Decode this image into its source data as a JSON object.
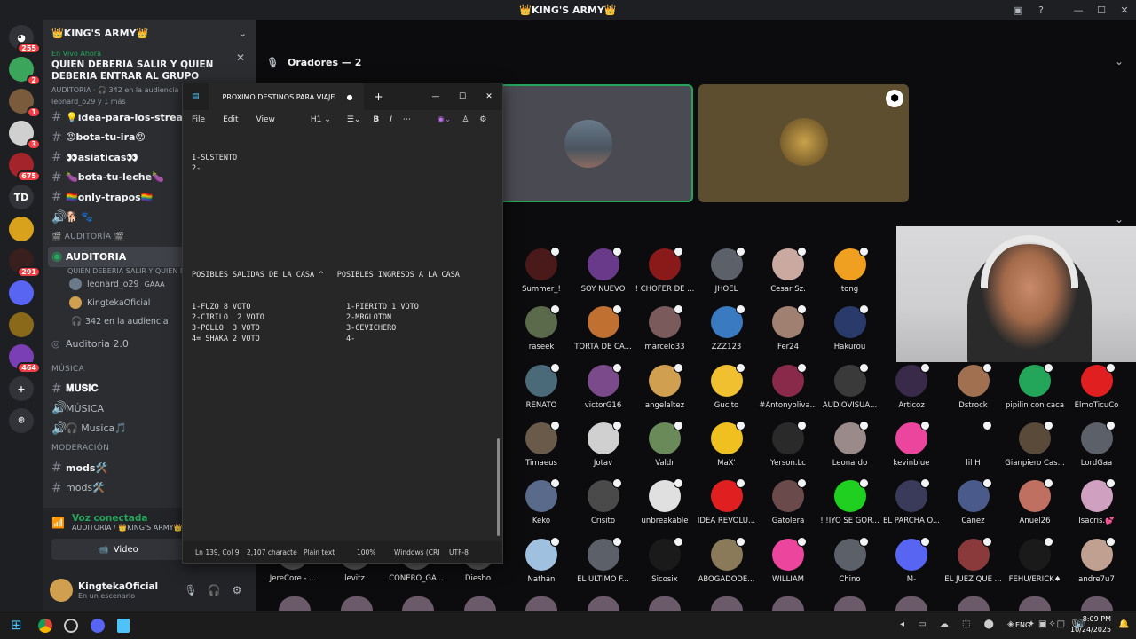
{
  "window": {
    "title": "👑KING'S ARMY👑"
  },
  "servers": [
    {
      "badge": "255",
      "color": "#5865f2",
      "label": ""
    },
    {
      "badge": "2",
      "color": "#3ba55c",
      "label": ""
    },
    {
      "badge": "1",
      "color": "#7a5c3c",
      "label": ""
    },
    {
      "badge": "3",
      "color": "#d0d0d0",
      "label": ""
    },
    {
      "badge": "675",
      "color": "#a3242a",
      "label": ""
    },
    {
      "badge": "",
      "color": "#313338",
      "label": "TD"
    },
    {
      "badge": "",
      "color": "#d9a21c",
      "label": ""
    },
    {
      "badge": "291",
      "color": "#3a1f1f",
      "label": ""
    },
    {
      "badge": "",
      "color": "#5865f2",
      "label": ""
    },
    {
      "badge": "",
      "color": "#8a6a1a",
      "label": ""
    },
    {
      "badge": "464",
      "color": "#7b3fb5",
      "label": ""
    }
  ],
  "sidebar": {
    "server_name": "👑KING'S ARMY👑",
    "live_label": "En Vivo Ahora",
    "stage_title": "QUIEN DEBERIA SALIR Y QUIEN DEBERIA ENTRAR AL GRUPO",
    "stage_meta": "AUDITORIA · 🎧 342 en la audiencia",
    "stage_users": "leonard_o29 y 1 más",
    "channels": [
      "💡idea-para-los-streams💡",
      "😡bota-tu-ira😡",
      "👀asiaticas👀",
      "🍆bota-tu-leche🍆",
      "🏳️‍🌈only-trapos🏳️‍🌈"
    ],
    "cat_auditoria": "🎬 AUDITORÍA 🎬",
    "auditoria_channel": "AUDITORIA",
    "auditoria_sub": "QUIEN DEBERIA SALIR Y QUIEN DEBERIA ENTRAR AL GRUPO",
    "members": [
      {
        "name": "leonard_o29",
        "tag": "GAAA"
      },
      {
        "name": "KingtekaOficial",
        "tag": ""
      }
    ],
    "audience": "342 en la audiencia",
    "auditoria2": "Auditoria 2.0",
    "cat_musica": "MÚSICA",
    "music_channels": [
      "𝐌𝐔𝐒𝐈𝐂",
      "MÚSICA",
      "🎧 Musica🎵"
    ],
    "cat_moderacion": "MODERACIÓN",
    "mod_channels": [
      "mods🛠️",
      "mods🛠️"
    ]
  },
  "voice_panel": {
    "status": "Voz conectada",
    "location": "AUDITORIA / 👑KING'S ARMY👑",
    "video_button": "Video"
  },
  "user_panel": {
    "name": "KingtekaOficial",
    "status": "En un escenario"
  },
  "stage": {
    "speakers_header": "Oradores — 2"
  },
  "notepad": {
    "title": "PROXIMO DESTINOS PARA VIAJE.",
    "menu": [
      "File",
      "Edit",
      "View"
    ],
    "heading": "H1",
    "lines": [
      "1-SUSTENTO",
      "2-",
      "",
      "",
      "",
      "",
      "",
      "",
      "",
      "",
      "",
      "POSIBLES SALIDAS DE LA CASA ^   POSIBLES INGRESOS A LA CASA",
      "",
      "",
      "1-FUZO 8 VOTO                     1-PIERITO 1 VOTO",
      "2-CIRILO  2 VOTO                  2-MRGLOTON",
      "3-POLLO  3 VOTO                   3-CEVICHERO",
      "4= SHAKA 2 VOTO                   4-"
    ],
    "status": {
      "pos": "Ln 139, Col 9",
      "chars": "2,107 characte",
      "format": "Plain text",
      "zoom": "100%",
      "eol": "Windows (CRI",
      "enc": "UTF-8"
    }
  },
  "audience": [
    {
      "name": "Summer_!",
      "color": "#4a1a1a"
    },
    {
      "name": "SOY NUEVO",
      "color": "#6a3a8a"
    },
    {
      "name": "! CHOFER DE ...",
      "color": "#8a1a1a"
    },
    {
      "name": "JHOEL",
      "color": "#5c6069"
    },
    {
      "name": "Cesar Sz.",
      "color": "#c9a9a0"
    },
    {
      "name": "tong",
      "color": "#f0a020"
    },
    {
      "name": "raseek",
      "color": "#5a6a4a"
    },
    {
      "name": "TORTA DE CA...",
      "color": "#c07030"
    },
    {
      "name": "marcelo33",
      "color": "#7a5a5a"
    },
    {
      "name": "ZZZ123",
      "color": "#3a7ac0"
    },
    {
      "name": "Fer24",
      "color": "#a08070"
    },
    {
      "name": "Hakurou",
      "color": "#2a3a6a"
    },
    {
      "name": "RENATO",
      "color": "#4a6a7a"
    },
    {
      "name": "victorG16",
      "color": "#7a4a8a"
    },
    {
      "name": "angelaltez",
      "color": "#d0a050"
    },
    {
      "name": "Gucito",
      "color": "#f0c030"
    },
    {
      "name": "#Antonyoliva...",
      "color": "#8a2a4a"
    },
    {
      "name": "AUDIOVISUA...",
      "color": "#3a3a3a"
    },
    {
      "name": "Articoz",
      "color": "#3a2a4a"
    },
    {
      "name": "Dstrock",
      "color": "#a07050"
    },
    {
      "name": "pipilin con caca",
      "color": "#23a55a"
    },
    {
      "name": "ElmoTicuCo",
      "color": "#e02020"
    },
    {
      "name": "Timaeus",
      "color": "#6a5a4a"
    },
    {
      "name": "Jotav",
      "color": "#d0d0d0"
    },
    {
      "name": "Valdr",
      "color": "#6a8a5a"
    },
    {
      "name": "MaX'",
      "color": "#f0c020"
    },
    {
      "name": "Yerson.Lc",
      "color": "#2a2a2a"
    },
    {
      "name": "Leonardo",
      "color": "#9a8a8a"
    },
    {
      "name": "kevinblue",
      "color": "#eb459e"
    },
    {
      "name": "lil H",
      "color": "#0c0c0e"
    },
    {
      "name": "Gianpiero Cas...",
      "color": "#5a4a3a"
    },
    {
      "name": "LordGaa",
      "color": "#5c6069"
    },
    {
      "name": "Keko",
      "color": "#5a6a8a"
    },
    {
      "name": "Crisito",
      "color": "#4a4a4a"
    },
    {
      "name": "unbreakable",
      "color": "#e0e0e0"
    },
    {
      "name": "IDEA REVOLU...",
      "color": "#e02020"
    },
    {
      "name": "Gatolera",
      "color": "#6a4a4a"
    },
    {
      "name": "! !IYO SE GOR...",
      "color": "#20d020"
    },
    {
      "name": "EL PARCHA O...",
      "color": "#3a3a5a"
    },
    {
      "name": "Cánez",
      "color": "#4a5a8a"
    },
    {
      "name": "Anuel26",
      "color": "#c07060"
    },
    {
      "name": "Isacris.💕",
      "color": "#d0a0c0"
    },
    {
      "name": "Nathán",
      "color": "#a0c0e0"
    },
    {
      "name": "EL ULTIMO F...",
      "color": "#5c6069"
    },
    {
      "name": "Sicosix",
      "color": "#1a1a1a"
    },
    {
      "name": "ABOGADODE...",
      "color": "#8a7a5a"
    },
    {
      "name": "WILLIAM",
      "color": "#eb459e"
    },
    {
      "name": "Chino",
      "color": "#5c6069"
    },
    {
      "name": "M-",
      "color": "#5865f2"
    },
    {
      "name": "EL JUEZ QUE ...",
      "color": "#8a3a3a"
    },
    {
      "name": "FEHU/ERICK♠",
      "color": "#1a1a1a"
    },
    {
      "name": "andre7u7",
      "color": "#c0a090"
    }
  ],
  "bottom_partial": [
    "JereCore - ...",
    "levitz",
    "CONERO_GA...",
    "Diesho"
  ],
  "taskbar": {
    "lang": "ENG",
    "time": "8:09 PM",
    "date": "10/24/2025"
  }
}
